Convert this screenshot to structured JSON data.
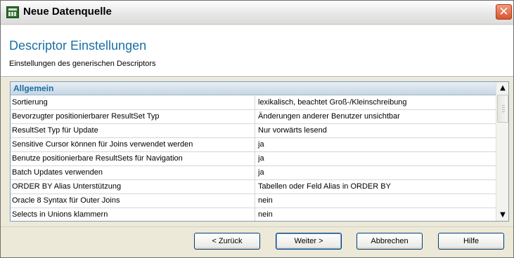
{
  "window": {
    "title": "Neue Datenquelle",
    "close_label": "✕"
  },
  "header": {
    "title": "Descriptor Einstellungen",
    "subtitle": "Einstellungen des generischen Descriptors"
  },
  "grid": {
    "section_label": "Allgemein",
    "rows": [
      {
        "name": "Sortierung",
        "value": "lexikalisch, beachtet Groß-/Kleinschreibung"
      },
      {
        "name": "Bevorzugter positionierbarer ResultSet Typ",
        "value": "Änderungen anderer Benutzer unsichtbar"
      },
      {
        "name": "ResultSet Typ für Update",
        "value": "Nur vorwärts lesend"
      },
      {
        "name": "Sensitive Cursor können für Joins verwendet werden",
        "value": "ja"
      },
      {
        "name": "Benutze positionierbare ResultSets für Navigation",
        "value": "ja"
      },
      {
        "name": "Batch Updates verwenden",
        "value": "ja"
      },
      {
        "name": "ORDER BY Alias Unterstützung",
        "value": "Tabellen oder Feld Alias in ORDER BY"
      },
      {
        "name": "Oracle 8 Syntax für Outer Joins",
        "value": "nein"
      },
      {
        "name": "Selects in Unions klammern",
        "value": "nein"
      }
    ]
  },
  "scrollbar": {
    "up_icon": "▲",
    "down_icon": "▼"
  },
  "buttons": {
    "back": "< Zurück",
    "next": "Weiter >",
    "cancel": "Abbrechen",
    "help": "Hilfe"
  }
}
